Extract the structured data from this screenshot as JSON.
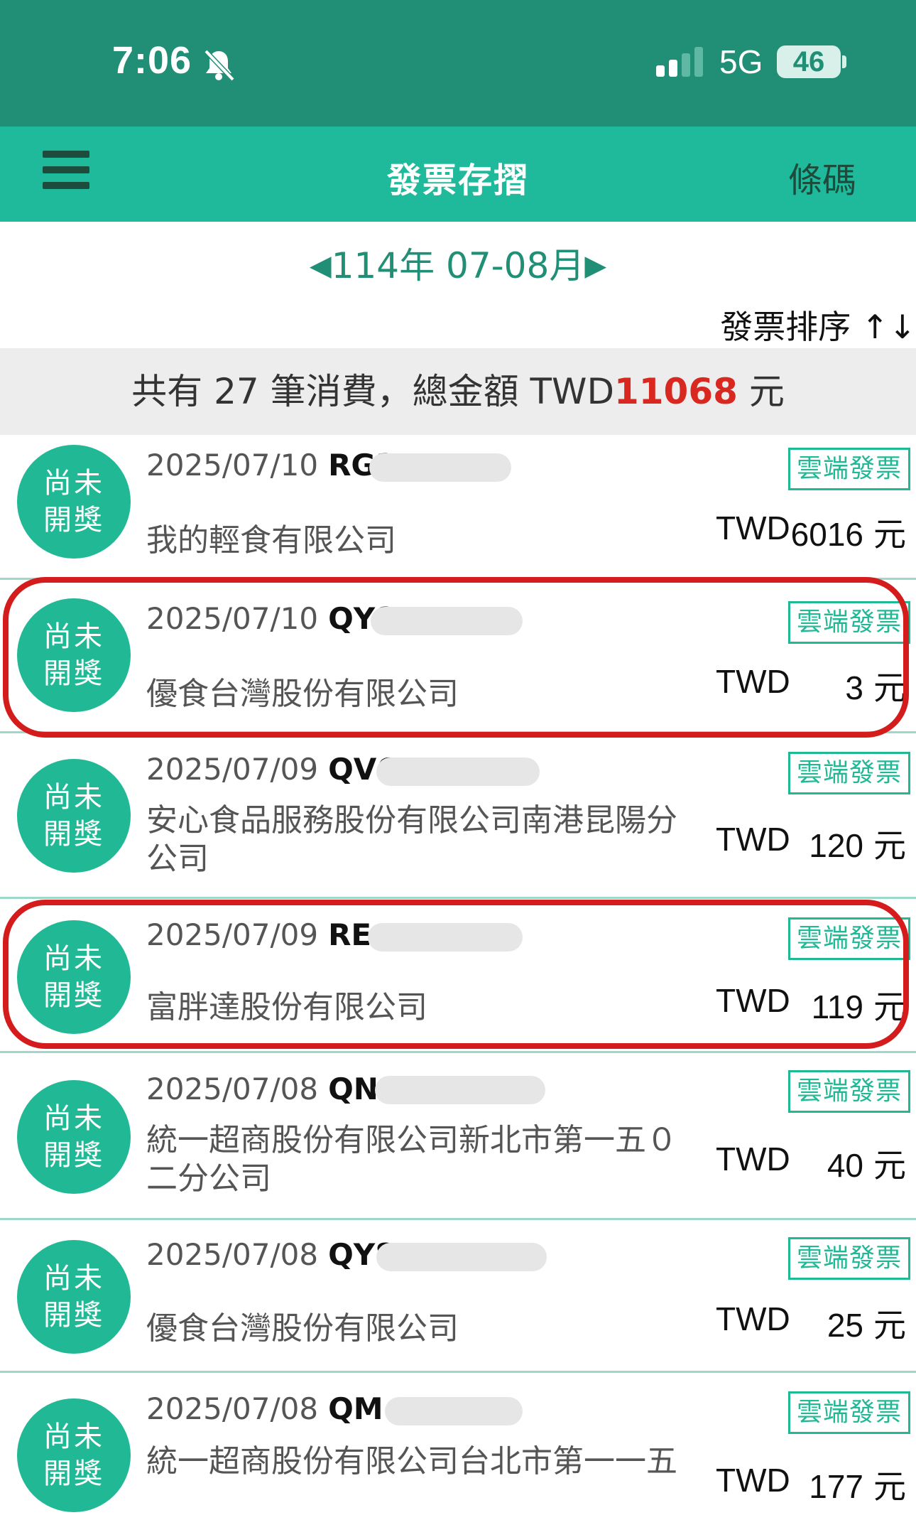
{
  "status_bar": {
    "time": "7:06",
    "network": "5G",
    "battery": "46"
  },
  "nav": {
    "title": "發票存摺",
    "barcode_label": "條碼"
  },
  "period": {
    "prev_arrow": "◀",
    "label": "114年 07-08月",
    "next_arrow": "▶"
  },
  "sort_label": "發票排序 ↑↓",
  "summary": {
    "prefix": "共有 27 筆消費，總金額 TWD",
    "total": "11068",
    "suffix": " 元"
  },
  "badge": {
    "line1": "尚未",
    "line2": "開獎"
  },
  "invoices": [
    {
      "date": "2025/07/10",
      "code": "RG3",
      "merchant": "我的輕食有限公司",
      "currency": "TWD",
      "amount": "6016",
      "unit": "元",
      "tag": "雲端發票"
    },
    {
      "date": "2025/07/10",
      "code": "QY8",
      "merchant": "優食台灣股份有限公司",
      "currency": "TWD",
      "amount": "3",
      "unit": "元",
      "tag": "雲端發票"
    },
    {
      "date": "2025/07/09",
      "code": "QV6",
      "merchant": "安心食品服務股份有限公司南港昆陽分公司",
      "currency": "TWD",
      "amount": "120",
      "unit": "元",
      "tag": "雲端發票"
    },
    {
      "date": "2025/07/09",
      "code": "RE",
      "merchant": "富胖達股份有限公司",
      "currency": "TWD",
      "amount": "119",
      "unit": "元",
      "tag": "雲端發票"
    },
    {
      "date": "2025/07/08",
      "code": "QN",
      "merchant": "統一超商股份有限公司新北市第一五０二分公司",
      "currency": "TWD",
      "amount": "40",
      "unit": "元",
      "tag": "雲端發票"
    },
    {
      "date": "2025/07/08",
      "code": "QY8",
      "merchant": "優食台灣股份有限公司",
      "currency": "TWD",
      "amount": "25",
      "unit": "元",
      "tag": "雲端發票"
    },
    {
      "date": "2025/07/08",
      "code": "QM",
      "merchant": "統一超商股份有限公司台北市第一一五",
      "currency": "TWD",
      "amount": "177",
      "unit": "元",
      "tag": "雲端發票"
    }
  ],
  "colors": {
    "status_bar": "#218f76",
    "nav_bar": "#1fba9b",
    "badge": "#20b895",
    "total_amount": "#d8281f",
    "highlight": "#d41c1c"
  }
}
